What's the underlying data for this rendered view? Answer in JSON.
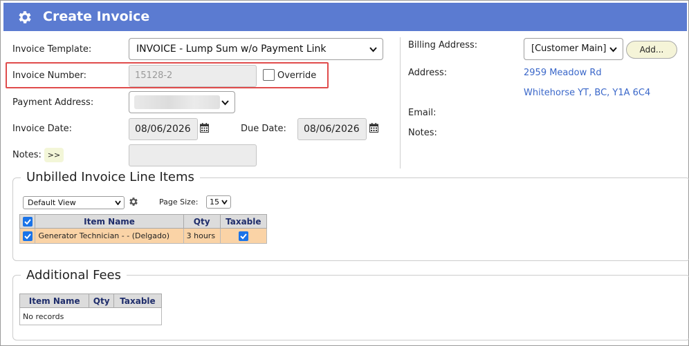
{
  "header": {
    "title": "Create Invoice",
    "icon": "gear-icon"
  },
  "form": {
    "invoice_template_label": "Invoice Template:",
    "invoice_template_value": "INVOICE - Lump Sum w/o Payment Link",
    "invoice_number_label": "Invoice Number:",
    "invoice_number_value": "15128-2",
    "override_label": "Override",
    "override_checked": false,
    "payment_address_label": "Payment Address:",
    "invoice_date_label": "Invoice Date:",
    "invoice_date_value": "08/06/2026",
    "due_date_label": "Due Date:",
    "due_date_value": "08/06/2026",
    "notes_label": "Notes:",
    "notes_button": ">>"
  },
  "billing": {
    "billing_address_label": "Billing Address:",
    "billing_address_value": "[Customer Main]",
    "add_button": "Add...",
    "address_label": "Address:",
    "address_line1": "2959 Meadow Rd",
    "address_line2": "Whitehorse YT, BC, Y1A 6C4",
    "email_label": "Email:",
    "notes_label": "Notes:"
  },
  "unbilled": {
    "legend": "Unbilled Invoice Line Items",
    "view_select": "Default View",
    "page_size_label": "Page Size:",
    "page_size_value": "15",
    "columns": [
      "Item Name",
      "Qty",
      "Taxable"
    ],
    "rows": [
      {
        "item_name": "Generator Technician - - (Delgado)",
        "qty": "3 hours",
        "taxable": true,
        "selected": true
      }
    ]
  },
  "fees": {
    "legend": "Additional Fees",
    "columns": [
      "Item Name",
      "Qty",
      "Taxable"
    ],
    "empty_text": "No records"
  },
  "colors": {
    "header_bg": "#5b7bd1",
    "highlight_border": "#e04b4b",
    "link": "#3a67c9",
    "selected_row": "#fad3a6",
    "checkbox_blue": "#1a73e8"
  }
}
